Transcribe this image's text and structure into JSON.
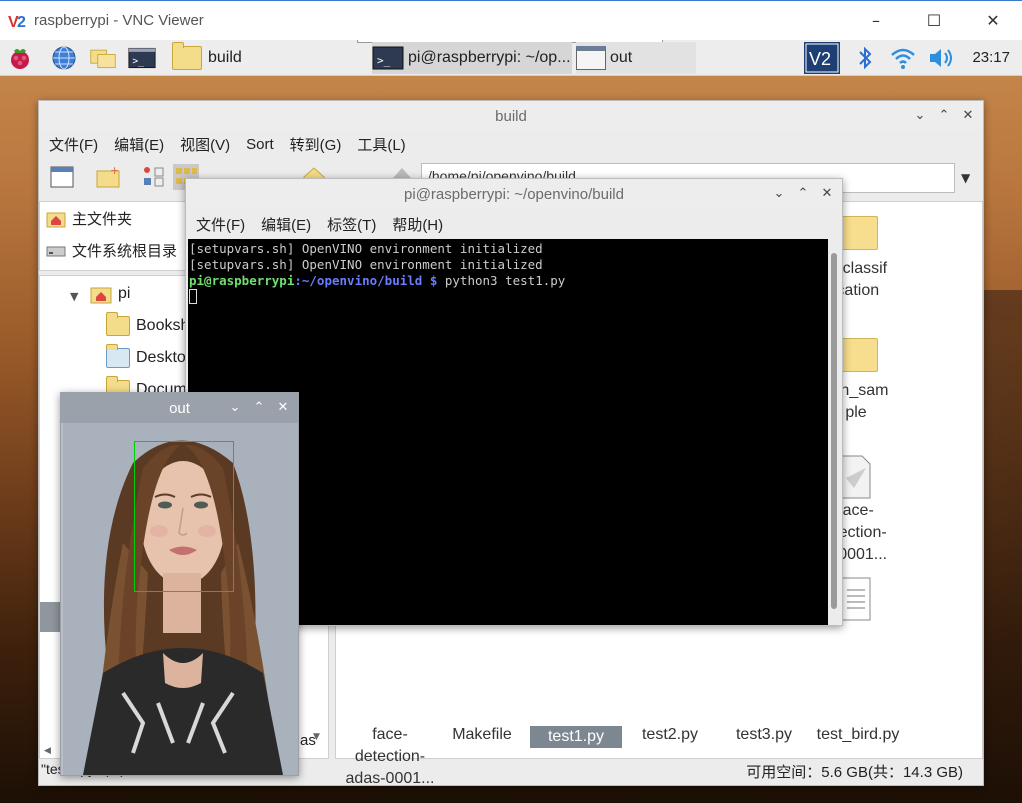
{
  "vnc": {
    "title": "raspberrypi - VNC Viewer"
  },
  "panel": {
    "tasks": [
      {
        "label": "build"
      },
      {
        "label": "pi@raspberrypi: ~/op..."
      },
      {
        "label": "out"
      }
    ],
    "clock": "23:17"
  },
  "file_manager": {
    "title": "build",
    "menu": [
      "文件(F)",
      "编辑(E)",
      "视图(V)",
      "Sort",
      "转到(G)",
      "工具(L)"
    ],
    "path": "/home/pi/openvino/build",
    "places": [
      "主文件夹",
      "文件系统根目录"
    ],
    "tree": {
      "root": "pi",
      "children": [
        "Bookshelf",
        "Desktop",
        "Documents"
      ],
      "partial_label": "as"
    },
    "files": [
      {
        "label_lines": [
          "o_classif",
          "ication"
        ],
        "type": "folder"
      },
      {
        "label_lines": [
          "ech_sam",
          "ple"
        ],
        "type": "folder"
      },
      {
        "label_lines": [
          "face-",
          "etection-",
          "s-0001..."
        ],
        "type": "document"
      },
      {
        "label_lines": [
          "face-",
          "detection-",
          "adas-0001..."
        ],
        "type": "file"
      },
      {
        "label_lines": [
          "Makefile"
        ],
        "type": "file"
      },
      {
        "label_lines": [
          "test1.py"
        ],
        "type": "file",
        "selected": true
      },
      {
        "label_lines": [
          "test2.py"
        ],
        "type": "file"
      },
      {
        "label_lines": [
          "test3.py"
        ],
        "type": "file"
      },
      {
        "label_lines": [
          "test_bird.py"
        ],
        "type": "file"
      }
    ],
    "status_left": "\"test1.py\" (...) ...",
    "status_right": "可用空间：5.6 GB(共：14.3 GB)"
  },
  "terminal": {
    "title": "pi@raspberrypi: ~/openvino/build",
    "menu": [
      "文件(F)",
      "编辑(E)",
      "标签(T)",
      "帮助(H)"
    ],
    "lines": [
      "[setupvars.sh] OpenVINO environment initialized",
      "[setupvars.sh] OpenVINO environment initialized"
    ],
    "prompt_user": "pi@raspberrypi",
    "prompt_path": ":~/openvino/build $",
    "command": " python3 test1.py"
  },
  "out_window": {
    "title": "out"
  },
  "colors": {
    "detection_box": "#00d100",
    "prompt_user": "#6ee06e",
    "prompt_path": "#6a7cff"
  }
}
